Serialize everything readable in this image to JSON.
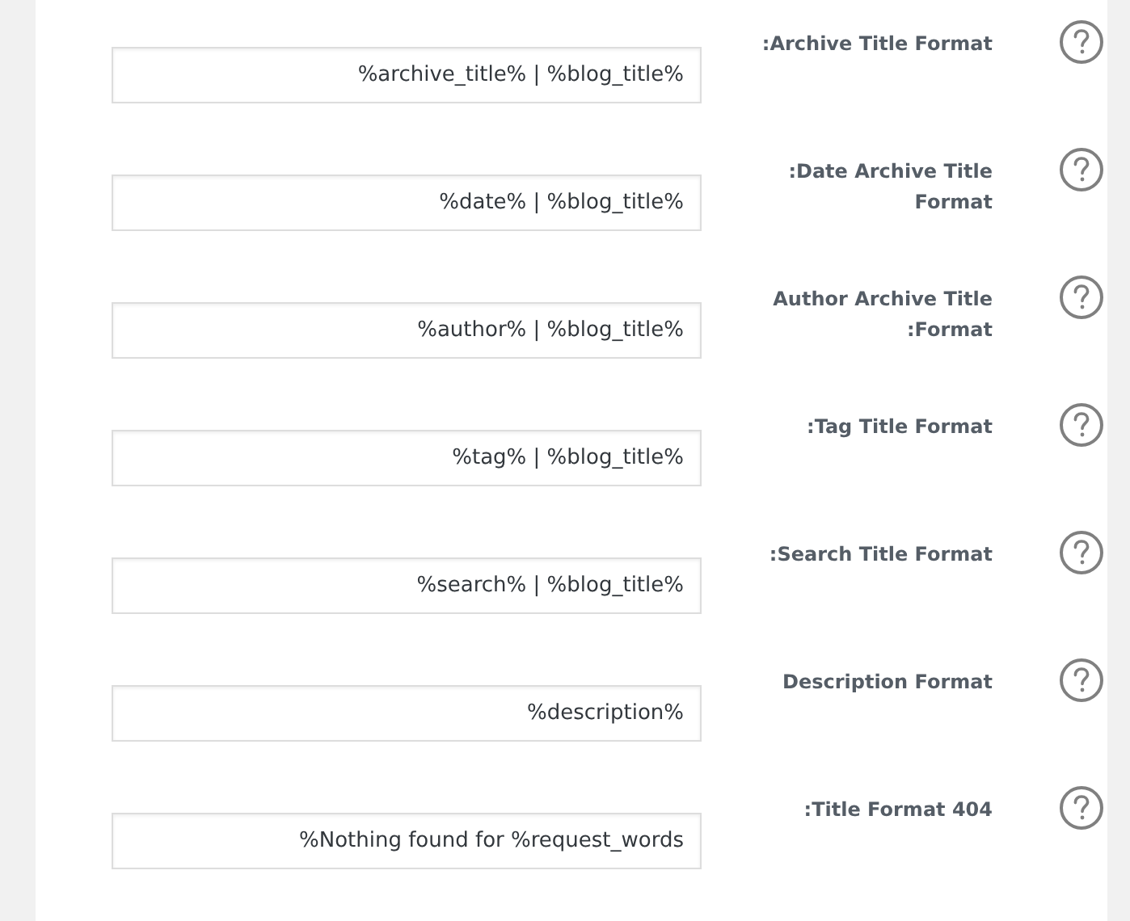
{
  "fields": [
    {
      "label": ":Archive Title Format",
      "value": "%archive_title% | %blog_title%"
    },
    {
      "label": ":Date Archive Title Format",
      "value": "%date% | %blog_title%"
    },
    {
      "label": "Author Archive Title :Format",
      "value": "%author% | %blog_title%"
    },
    {
      "label": ":Tag Title Format",
      "value": "%tag% | %blog_title%"
    },
    {
      "label": ":Search Title Format",
      "value": "%search% | %blog_title%"
    },
    {
      "label": "Description Format",
      "value": "%description%"
    },
    {
      "label": ":Title Format 404",
      "value": "%Nothing found for %request_words"
    }
  ]
}
